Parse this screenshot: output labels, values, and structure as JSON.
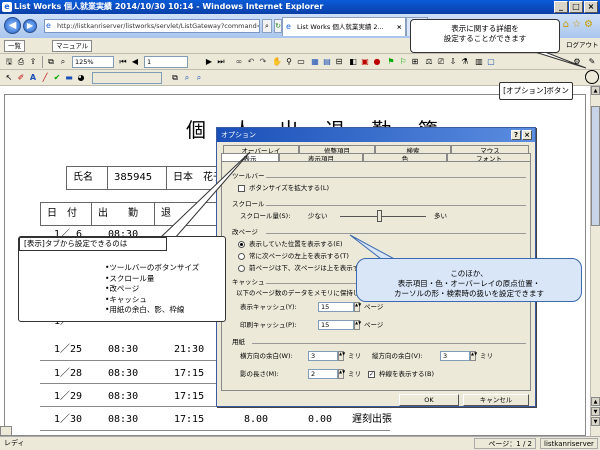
{
  "window": {
    "title": "List Works 個人就業実績 2014/10/30 10:14 - Windows Internet Explorer",
    "min": "_",
    "max": "□",
    "close": "×"
  },
  "browser": {
    "url": "http://listkanriserver/listworks/servlet/ListGateway?command=listbrov",
    "tab_label": "List Works 個人就業実績 2...",
    "tab_close": "×",
    "back_icon": "arrow-left",
    "forward_icon": "arrow-right"
  },
  "toolbar1": {
    "btn_list": "一覧",
    "btn_manual": "マニュアル",
    "right_label": "ログアウト"
  },
  "toolbar2": {
    "zoom": "125%",
    "page": "1"
  },
  "document": {
    "title": "個 人 出 退 勤 簿",
    "name_label": "氏名",
    "emp_no": "385945",
    "emp_name": "日本　花子",
    "col_date": "日　付",
    "col_in": "出　　勤",
    "col_out": "退",
    "rows": [
      {
        "date": "1／ 6",
        "in": "08:30",
        "out": ""
      },
      {
        "date": "1／25",
        "in": "08:30",
        "out": "21:30"
      },
      {
        "date": "1／28",
        "in": "08:30",
        "out": "17:15"
      },
      {
        "date": "1／29",
        "in": "08:30",
        "out": "17:15"
      },
      {
        "date": "1／30",
        "in": "08:30",
        "out": "17:15"
      }
    ],
    "last_row_extra": "8.00",
    "last_row_extra2": "0.00",
    "last_row_note": "遅刻出張"
  },
  "status": {
    "left": "レディ",
    "page": "ページ：1 / 2",
    "server": "listkanriserver"
  },
  "dialog": {
    "title": "オプション",
    "help": "?",
    "close": "×",
    "tabs_back": [
      "オーバーレイ",
      "修整項目",
      "検索",
      "マウス"
    ],
    "tabs_front": [
      "表示",
      "表示項目",
      "色",
      "フォント"
    ],
    "grp_toolbar": "ツールバー",
    "chk_bigbtn": "ボタンサイズを拡大する(L)",
    "grp_scroll": "スクロール",
    "scroll_amount": "スクロール量(S):",
    "scroll_less": "少ない",
    "scroll_more": "多い",
    "grp_page": "改ページ",
    "radio1": "表示していた位置を表示する(E)",
    "radio2": "常に次ページの左上を表示する(T)",
    "radio3": "前ページは下、次ページは上を表示する(O)",
    "grp_cache": "キャッシュ",
    "cache_desc": "以下のページ数のデータをメモリに保持します。",
    "disp_cache": "表示キャッシュ(Y):",
    "disp_cache_val": "15",
    "print_cache": "印刷キャッシュ(P):",
    "print_cache_val": "15",
    "unit_page": "ページ",
    "grp_paper": "用紙",
    "margin_h": "横方向の余白(W):",
    "margin_h_val": "3",
    "margin_v": "縦方向の余白(V):",
    "margin_v_val": "3",
    "shadow": "影の長さ(M):",
    "shadow_val": "2",
    "unit_mm": "ミリ",
    "chk_frame": "枠線を表示する(B)",
    "ok": "OK",
    "cancel": "キャンセル"
  },
  "callouts": {
    "top": [
      "表示に関する詳細を",
      "設定することができます"
    ],
    "option_button": "[オプション]ボタン",
    "left_head": "[表示]タブから設定できるのは",
    "left_items": [
      "•ツールバーのボタンサイズ",
      "•スクロール量",
      "•改ページ",
      "•キャッシュ",
      "•用紙の余白、影、枠線"
    ],
    "right": [
      "このほか、",
      "表示項目・色・オーバーレイの原点位置・",
      "カーソルの形・検索時の扱いを設定できます"
    ]
  }
}
